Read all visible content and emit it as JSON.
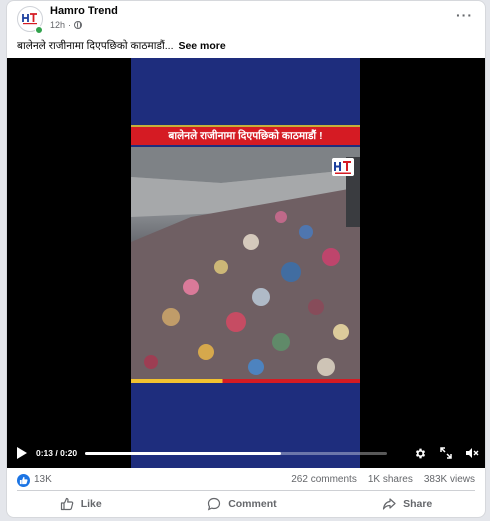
{
  "post": {
    "page_name": "Hamro Trend",
    "time": "12h",
    "separator": "·",
    "caption": "बालेनले राजीनामा दिएपछिको काठमाडौं...",
    "see_more": "See more"
  },
  "video": {
    "headline": "बालेनले राजीनामा दिएपछिको काठमाडौं !",
    "time_current": "0:13",
    "time_total": "0:20",
    "time_display": "0:13 / 0:20",
    "progress": 0.65
  },
  "stats": {
    "likes": "13K",
    "comments": "262 comments",
    "shares": "1K shares",
    "views": "383K views"
  },
  "actions": {
    "like": "Like",
    "comment": "Comment",
    "share": "Share"
  },
  "colors": {
    "brand_blue": "#1b74e4",
    "headline_red": "#d51b23",
    "video_bg": "#1e2d7d"
  }
}
